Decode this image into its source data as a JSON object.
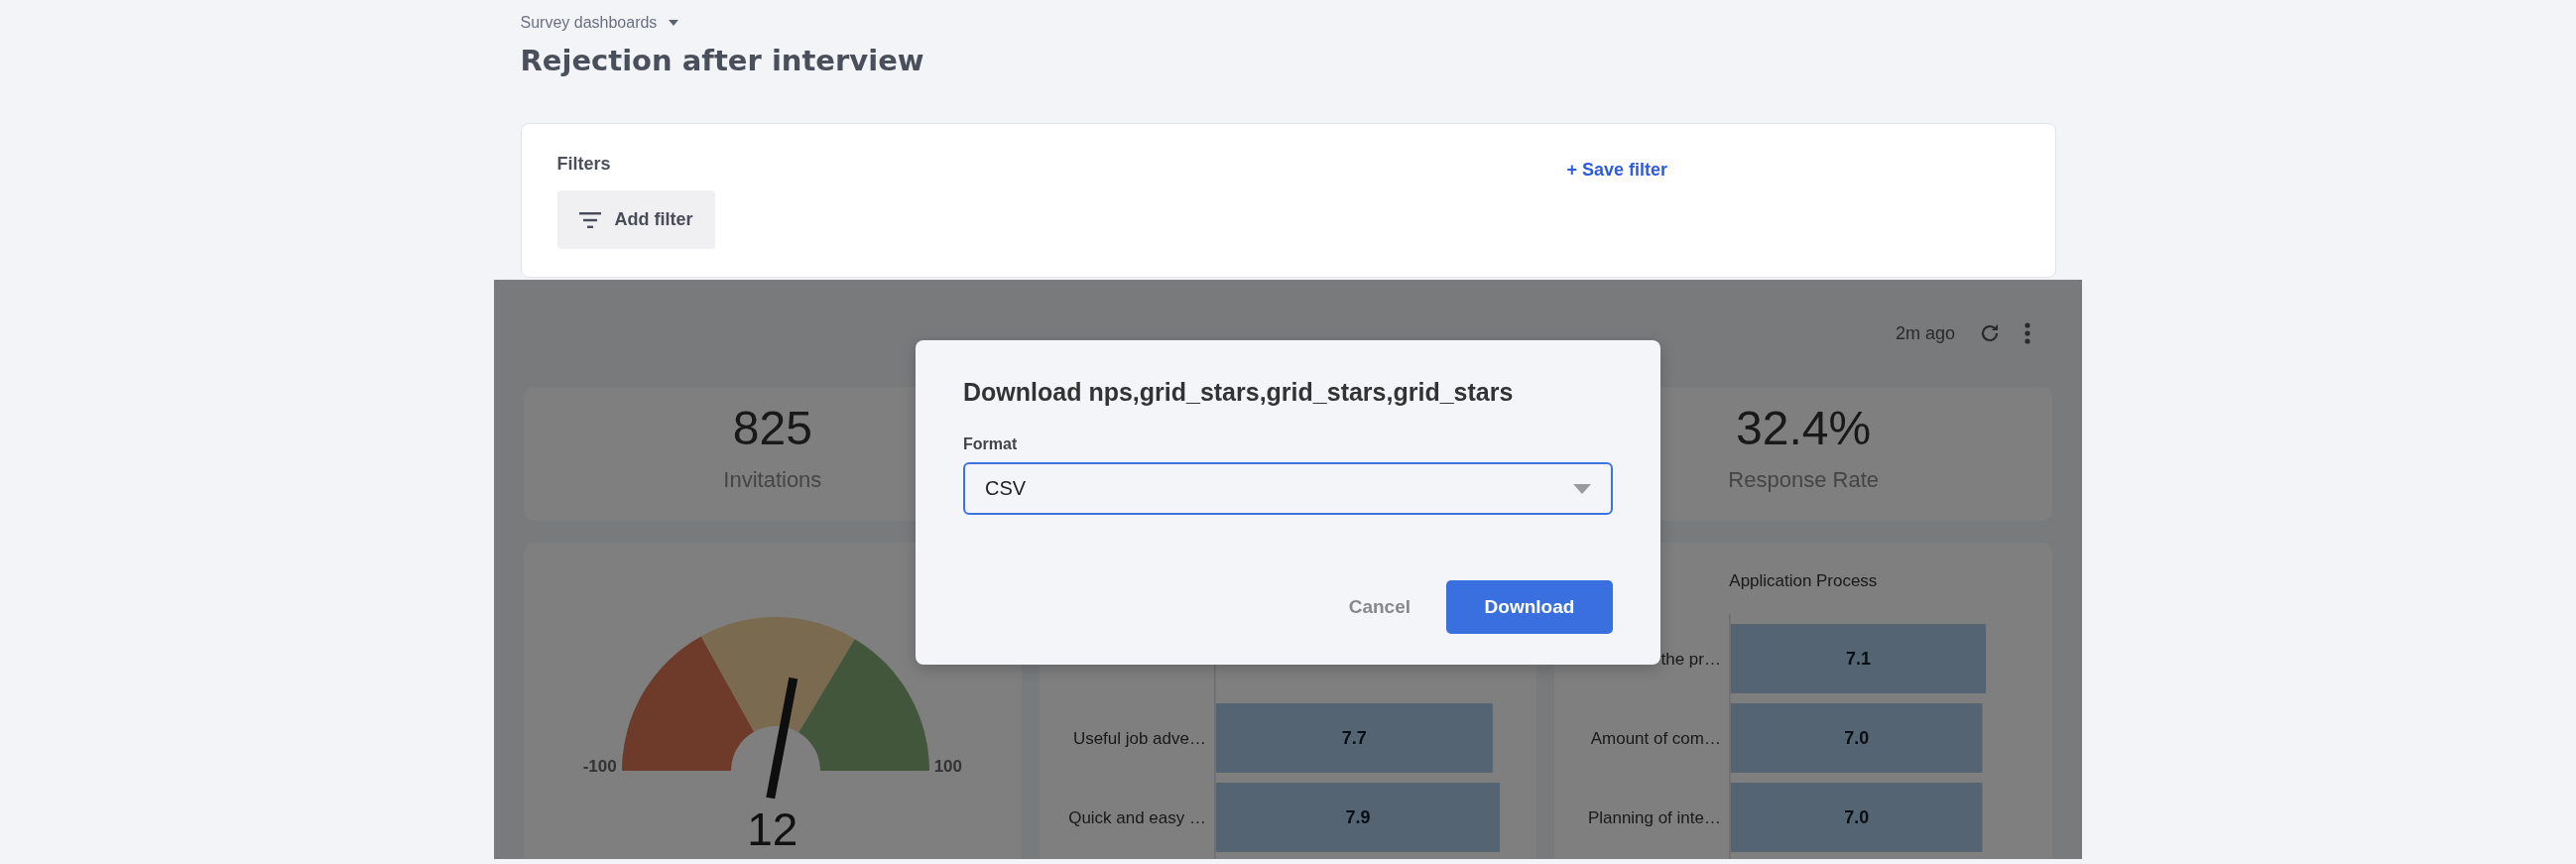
{
  "breadcrumb": {
    "label": "Survey dashboards"
  },
  "title": "Rejection after interview",
  "filters": {
    "heading": "Filters",
    "add_button": "Add filter",
    "save_link": "+ Save filter"
  },
  "dashboard": {
    "updated": "2m ago",
    "kpis": [
      {
        "value": "825",
        "label": "Invitations"
      },
      {
        "value": "32.4%",
        "label": "Response Rate"
      }
    ],
    "nps_gauge": {
      "value": "12",
      "min_label": "-100",
      "max_label": "100",
      "level": 0.56
    },
    "charts": [
      {
        "chart_data": {
          "type": "bar",
          "orientation": "horizontal",
          "categories": [
            "Useful job adve…",
            "Quick and easy …"
          ],
          "values": [
            7.7,
            7.9
          ],
          "value_labels": [
            "7.7",
            "7.9"
          ]
        }
      },
      {
        "chart_data": {
          "type": "bar",
          "orientation": "horizontal",
          "title": "Application Process",
          "categories": [
            "the pr…",
            "Amount of com…",
            "Planning of inte…"
          ],
          "values": [
            7.1,
            7.0,
            7.0
          ],
          "value_labels": [
            "7.1",
            "7.0",
            "7.0"
          ]
        }
      }
    ]
  },
  "dialog": {
    "title": "Download nps,grid_stars,grid_stars,grid_stars",
    "format_label": "Format",
    "format_value": "CSV",
    "buttons": [
      {
        "label": "Cancel",
        "kind": "secondary"
      },
      {
        "label": "Download",
        "kind": "primary"
      }
    ]
  }
}
